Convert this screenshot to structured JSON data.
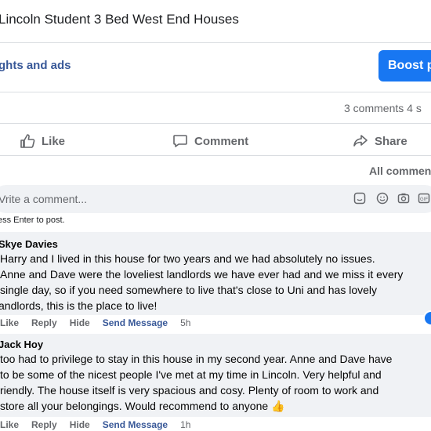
{
  "post": {
    "title": "Lincoln Student 3 Bed West End Houses"
  },
  "insights": {
    "label": "ghts and ads",
    "boost_label": "Boost p"
  },
  "stats": {
    "counts": "3 comments  4 s"
  },
  "actions": {
    "like": "Like",
    "comment": "Comment",
    "share": "Share"
  },
  "filter": {
    "all_comments": "All commen"
  },
  "composer": {
    "placeholder": "Vrite a comment...",
    "hint": "ess Enter to post.",
    "icons": [
      "sticker-icon",
      "emoji-icon",
      "camera-icon",
      "gif-icon"
    ]
  },
  "comments": [
    {
      "author": "Skye Davies",
      "lines": [
        "Harry and I lived in this house for two years and we had absolutely no issues.",
        "Anne and Dave were the loveliest landlords we have ever had and we miss it every",
        "single day, so if you need somewhere to live that's close to Uni and has lovely",
        "andlords, this is the place to live!"
      ],
      "like": "Like",
      "reply": "Reply",
      "hide": "Hide",
      "send_message": "Send Message",
      "time": "5h"
    },
    {
      "author": "Jack Hoy",
      "lines": [
        "too had to privilege to stay in this house in my second year. Anne and Dave have",
        "to be some of the nicest people I've met at my time in Lincoln. Very helpful and",
        "riendly. The house itself is very spacious and cosy. Plenty of room to work and",
        "store all your belongings. Would recommend to anyone 👍"
      ],
      "like": "Like",
      "reply": "Reply",
      "hide": "Hide",
      "send_message": "Send Message",
      "time": "1h"
    }
  ],
  "colors": {
    "accent": "#1877f2",
    "link": "#385898",
    "muted": "#65676b",
    "bubble": "#f0f2f5"
  }
}
